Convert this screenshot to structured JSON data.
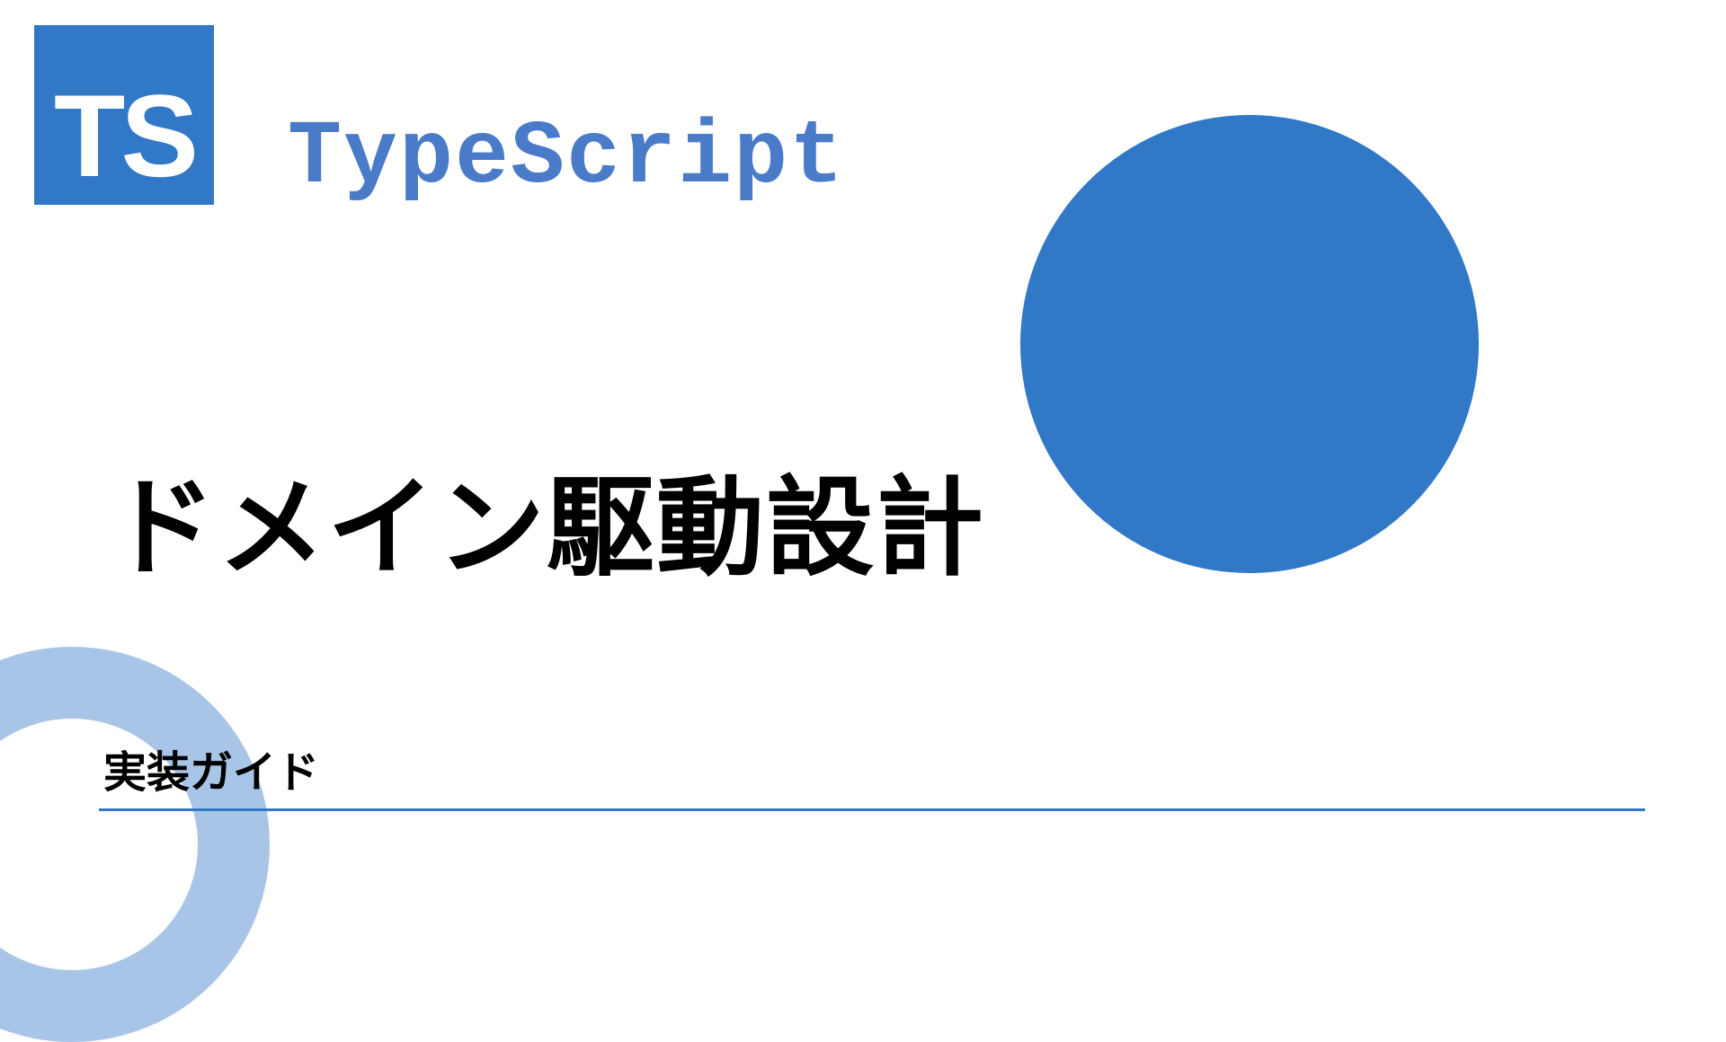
{
  "logo": {
    "text": "TS"
  },
  "header": {
    "language_label": "TypeScript"
  },
  "main": {
    "title": "ドメイン駆動設計",
    "subtitle": "実装ガイド"
  },
  "colors": {
    "primary": "#3178c6",
    "ring": "#a8c5e8",
    "text_accent": "#4a7bc8"
  }
}
